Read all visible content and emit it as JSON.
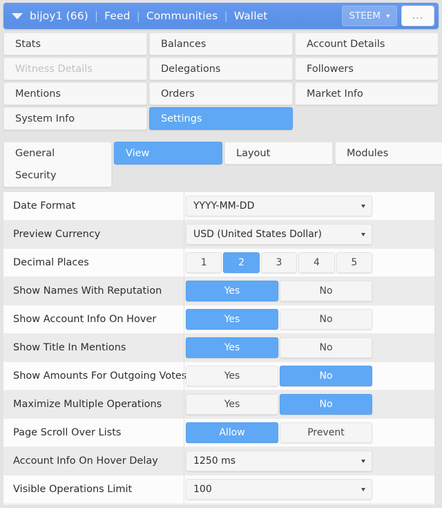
{
  "navbar": {
    "caret_icon": "triangle-down-icon",
    "account": "bijoy1 (66)",
    "sep": "|",
    "links": [
      "Feed",
      "Communities",
      "Wallet"
    ],
    "currency_button": "STEEM",
    "currency_caret_icon": "caret-down-icon",
    "more_button": "...",
    "bg_color": "#5e93ea"
  },
  "tabs": [
    {
      "label": "Stats",
      "state": "normal"
    },
    {
      "label": "Balances",
      "state": "normal"
    },
    {
      "label": "Account Details",
      "state": "normal"
    },
    {
      "label": "Witness Details",
      "state": "disabled"
    },
    {
      "label": "Delegations",
      "state": "normal"
    },
    {
      "label": "Followers",
      "state": "normal"
    },
    {
      "label": "Mentions",
      "state": "normal"
    },
    {
      "label": "Orders",
      "state": "normal"
    },
    {
      "label": "Market Info",
      "state": "normal"
    },
    {
      "label": "System Info",
      "state": "normal"
    },
    {
      "label": "Settings",
      "state": "active"
    },
    {
      "label": "",
      "state": "empty"
    }
  ],
  "subtabs": {
    "general": "General",
    "security": "Security",
    "view": "View",
    "layout": "Layout",
    "modules": "Modules",
    "active": "View"
  },
  "settings": {
    "rows": [
      {
        "label": "Date Format",
        "type": "select",
        "value": "YYYY-MM-DD"
      },
      {
        "label": "Preview Currency",
        "type": "select",
        "value": "USD (United States Dollar)"
      },
      {
        "label": "Decimal Places",
        "type": "segments",
        "options": [
          "1",
          "2",
          "3",
          "4",
          "5"
        ],
        "selected": "2"
      },
      {
        "label": "Show Names With Reputation",
        "type": "segments",
        "options": [
          "Yes",
          "No"
        ],
        "selected": "Yes"
      },
      {
        "label": "Show Account Info On Hover",
        "type": "segments",
        "options": [
          "Yes",
          "No"
        ],
        "selected": "Yes"
      },
      {
        "label": "Show Title In Mentions",
        "type": "segments",
        "options": [
          "Yes",
          "No"
        ],
        "selected": "Yes"
      },
      {
        "label": "Show Amounts For Outgoing Votes",
        "type": "segments",
        "options": [
          "Yes",
          "No"
        ],
        "selected": "No"
      },
      {
        "label": "Maximize Multiple Operations",
        "type": "segments",
        "options": [
          "Yes",
          "No"
        ],
        "selected": "No"
      },
      {
        "label": "Page Scroll Over Lists",
        "type": "segments",
        "options": [
          "Allow",
          "Prevent"
        ],
        "selected": "Allow"
      },
      {
        "label": "Account Info On Hover Delay",
        "type": "select",
        "value": "1250 ms"
      },
      {
        "label": "Visible Operations Limit",
        "type": "select",
        "value": "100"
      }
    ]
  },
  "theme": {
    "accent": "#5fa8f5",
    "navbar": "#5e93ea",
    "row_alt": "#ebebeb",
    "page_bg": "#e4e4e4"
  }
}
